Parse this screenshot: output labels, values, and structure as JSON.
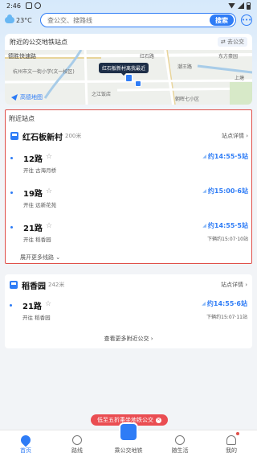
{
  "status_bar": {
    "time": "2:46"
  },
  "header": {
    "weather_temp": "23°C",
    "search_placeholder": "查公交、搜路线",
    "search_button": "搜索"
  },
  "map_card": {
    "title": "附近的公交地铁站点",
    "link": "⇄ 去公交",
    "tooltip": "红石板新村离我最近",
    "labels": [
      "德胜快速路",
      "杭州市文一街小学(文一校区)",
      "红石路",
      "东方豪园",
      "潮王路",
      "上塘",
      "之江饭店",
      "朝晖七小区"
    ],
    "logo": "高德地图"
  },
  "nearby": {
    "section_title": "附近站点",
    "stop": {
      "name": "红石板新村",
      "distance": "200米",
      "detail": "站点详情 ›"
    },
    "routes": [
      {
        "name": "12路",
        "direction": "开往 古海月桥",
        "eta": "约14:55·5站",
        "next": ""
      },
      {
        "name": "19路",
        "direction": "开往 远新花苑",
        "eta": "约15:00·6站",
        "next": ""
      },
      {
        "name": "21路",
        "direction": "开往 稻香园",
        "eta": "约14:55·5站",
        "next": "下辆约15:07·10站"
      }
    ],
    "expand_more": "展开更多线路 ⌄"
  },
  "second_stop": {
    "name": "稻香园",
    "distance": "242米",
    "detail": "站点详情 ›",
    "route": {
      "name": "21路",
      "direction": "开往 稻香园",
      "eta": "约14:55·6站",
      "next": "下辆约15:07·11站"
    },
    "view_more": "查看更多附近公交 ›"
  },
  "promo": {
    "text": "低至五折乘坐地铁公交"
  },
  "tabbar": {
    "tabs": [
      {
        "label": "首页"
      },
      {
        "label": "路线"
      },
      {
        "label": "乘公交地铁"
      },
      {
        "label": "随生活"
      },
      {
        "label": "我的"
      }
    ]
  },
  "colors": {
    "accent": "#2e7cf6",
    "highlight_border": "#e0504a",
    "promo": "#ea4d52"
  }
}
